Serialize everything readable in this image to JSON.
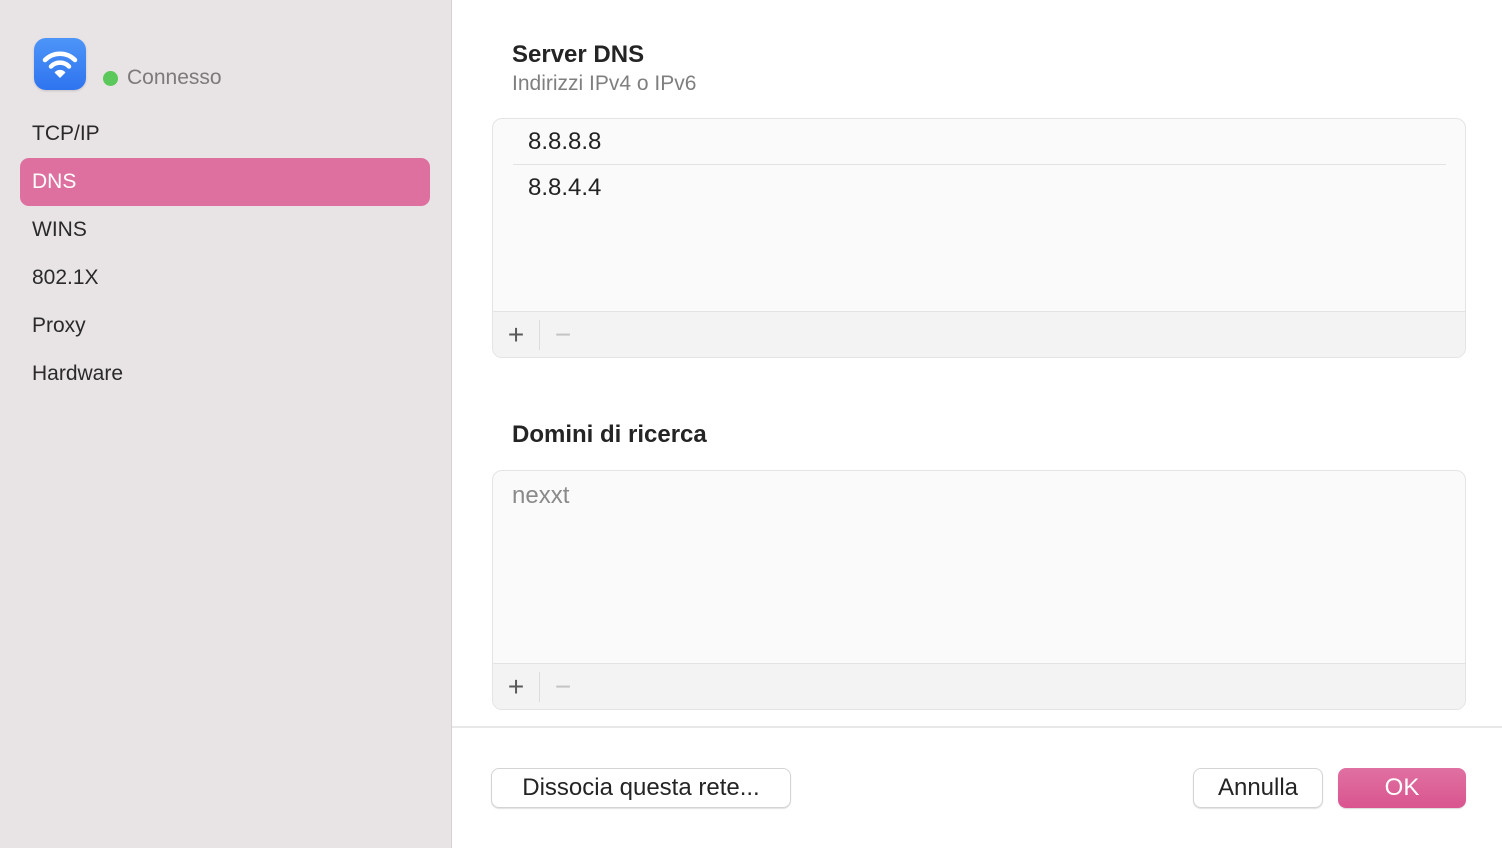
{
  "status": {
    "label": "Connesso",
    "color": "#5ac85a",
    "icon": "wifi-icon"
  },
  "sidebar": {
    "items": [
      {
        "label": "TCP/IP",
        "active": false
      },
      {
        "label": "DNS",
        "active": true
      },
      {
        "label": "WINS",
        "active": false
      },
      {
        "label": "802.1X",
        "active": false
      },
      {
        "label": "Proxy",
        "active": false
      },
      {
        "label": "Hardware",
        "active": false
      }
    ],
    "accent": "#de70a0"
  },
  "dns": {
    "title": "Server DNS",
    "subtitle": "Indirizzi IPv4 o IPv6",
    "servers": [
      "8.8.8.8",
      "8.8.4.4"
    ],
    "add_label": "+",
    "remove_label": "−"
  },
  "search_domains": {
    "title": "Domini di ricerca",
    "placeholder": "nexxt",
    "add_label": "+",
    "remove_label": "−"
  },
  "footer": {
    "forget_label": "Dissocia questa rete...",
    "cancel_label": "Annulla",
    "ok_label": "OK"
  }
}
